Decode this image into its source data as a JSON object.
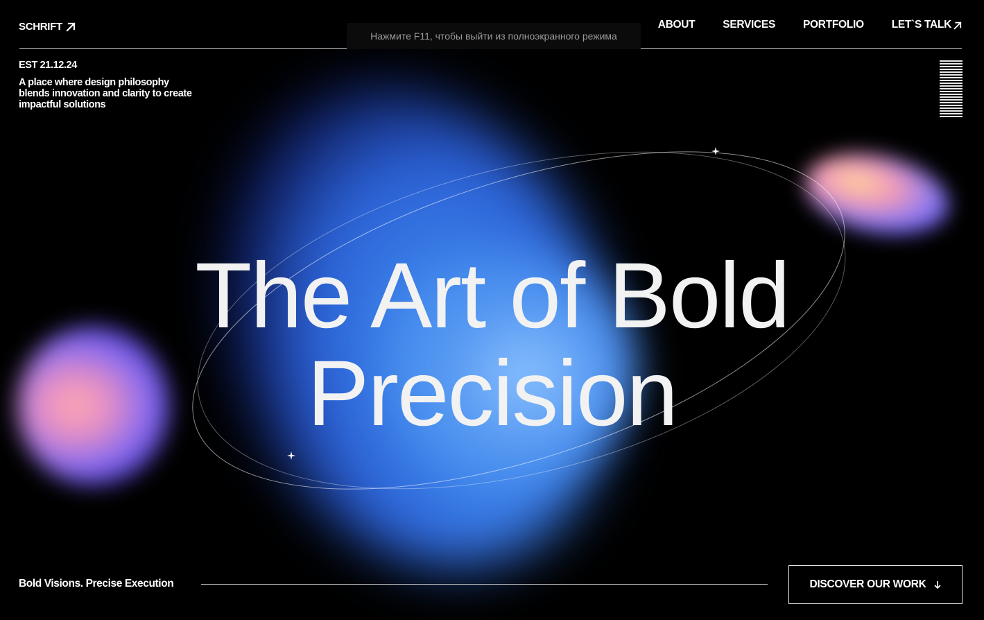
{
  "header": {
    "brand": "SCHRIFT",
    "nav": [
      {
        "label": "ABOUT"
      },
      {
        "label": "SERVICES"
      },
      {
        "label": "PORTFOLIO"
      },
      {
        "label": "LET`S TALK"
      }
    ]
  },
  "fullscreen_notice": "Нажмите F11, чтобы выйти из полноэкранного режима",
  "intro": {
    "est": "EST 21.12.24",
    "tagline": "A place where design philosophy blends innovation and clarity to create impactful solutions"
  },
  "hero": {
    "line1": "The Art of Bold",
    "line2": "Precision"
  },
  "footer": {
    "caption": "Bold Visions. Precise Execution",
    "cta_label": "DISCOVER OUR WORK"
  },
  "icons": {
    "brand_arrow": "arrow-up-right-icon",
    "talk_arrow": "arrow-up-right-icon",
    "menu": "menu-bars-icon",
    "cta_arrow": "arrow-down-icon",
    "stars": "sparkle-icon"
  },
  "colors": {
    "background": "#000000",
    "text": "#ffffff",
    "blob_blue": "#3a7ee8",
    "blob_pink": "#f29ab8",
    "blob_violet": "#8a6cf0",
    "blob_gold": "#ffd79a"
  }
}
